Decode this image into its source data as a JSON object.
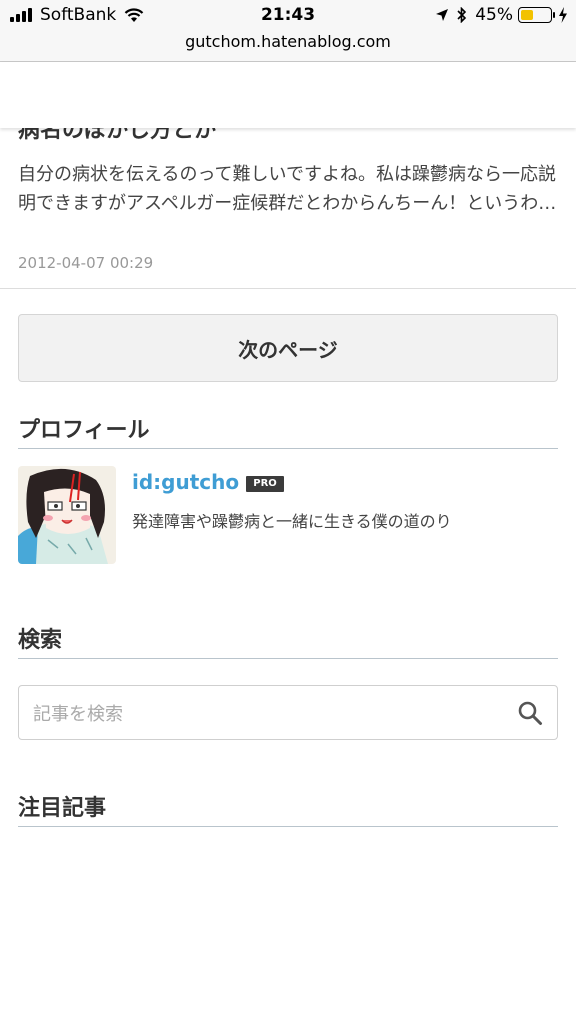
{
  "status_bar": {
    "carrier": "SoftBank",
    "time": "21:43",
    "battery": "45%",
    "battery_level": 0.45
  },
  "browser": {
    "url": "gutchom.hatenablog.com"
  },
  "entry": {
    "title_partial": "病名のぼかし方とか",
    "excerpt": "自分の病状を伝えるのって難しいですよね。私は躁鬱病なら一応説明できますがアスペルガー症候群だとわからんちーん！というわ…",
    "date": "2012-04-07 00:29"
  },
  "pager": {
    "next_label": "次のページ"
  },
  "profile": {
    "heading": "プロフィール",
    "id": "id:gutcho",
    "badge": "PRO",
    "description": "発達障害や躁鬱病と一緒に生きる僕の道のり"
  },
  "search": {
    "heading": "検索",
    "placeholder": "記事を検索",
    "icon": "search-icon"
  },
  "featured": {
    "heading": "注目記事"
  }
}
